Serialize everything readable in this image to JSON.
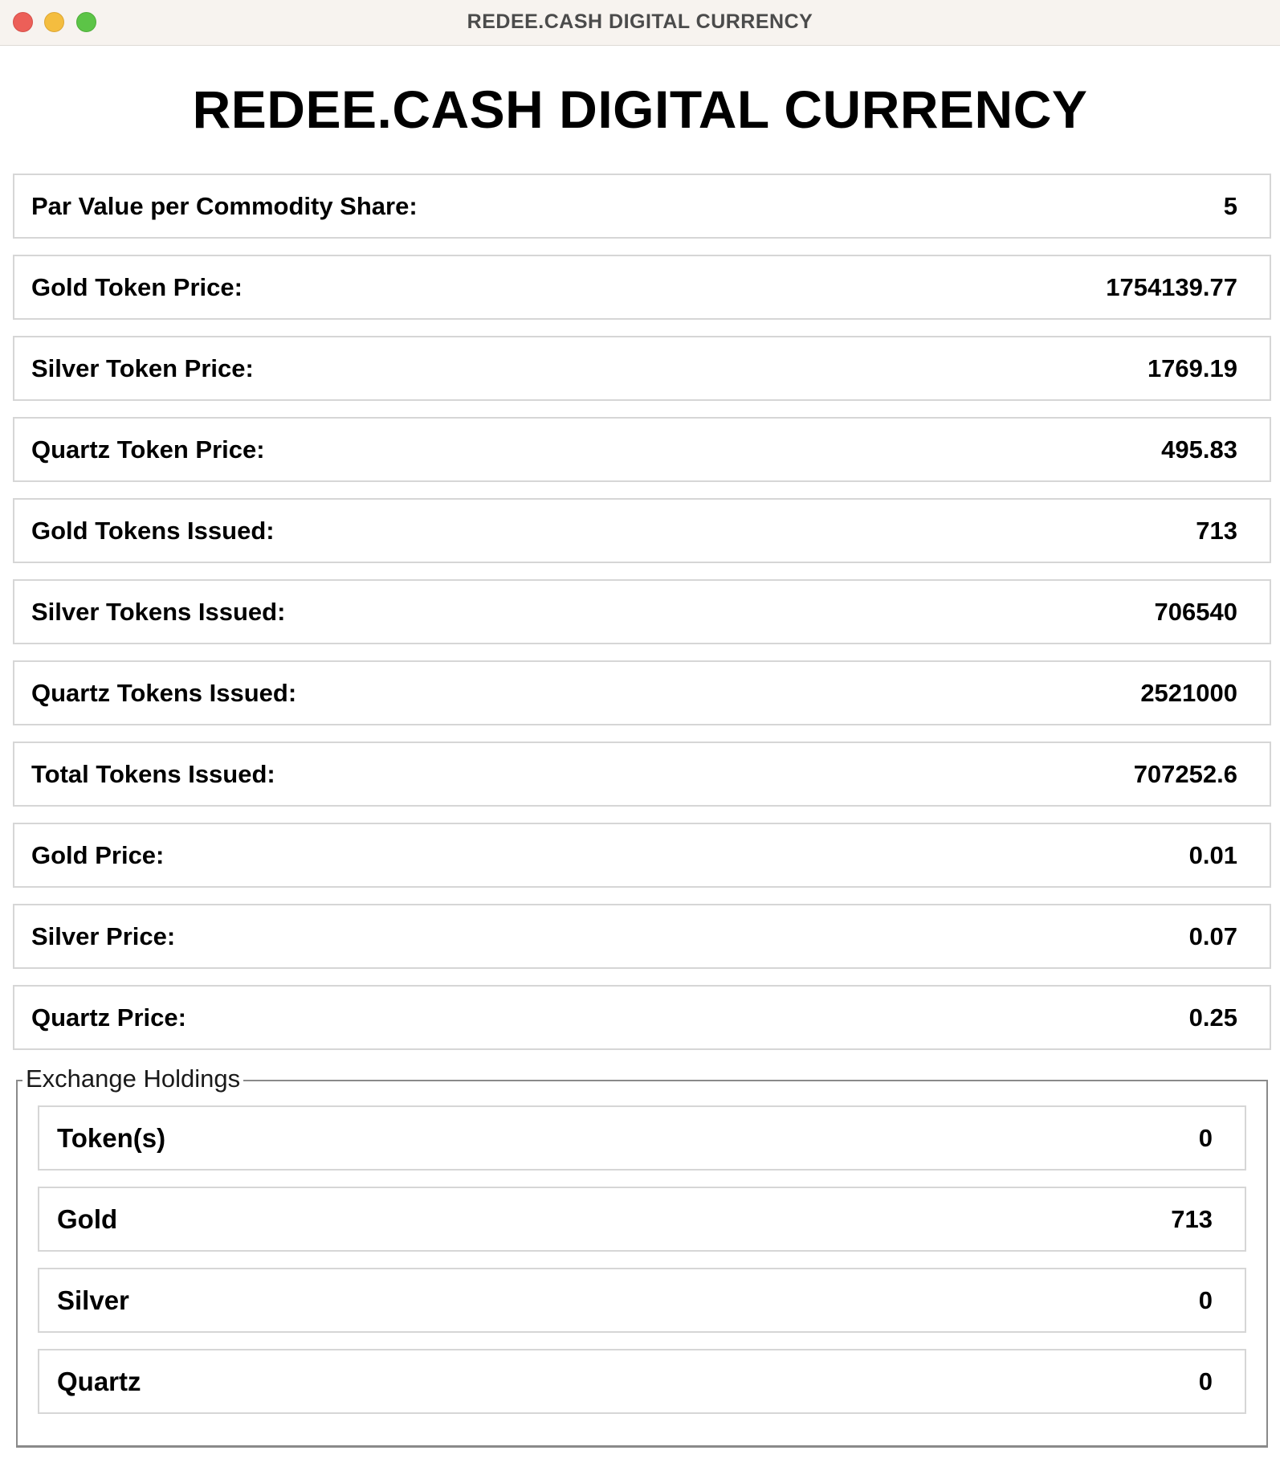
{
  "window": {
    "title": "REDEE.CASH DIGITAL CURRENCY"
  },
  "heading": "REDEE.CASH DIGITAL CURRENCY",
  "stats": [
    {
      "label": "Par Value per Commodity Share:",
      "value": "5"
    },
    {
      "label": "Gold Token Price:",
      "value": "1754139.77"
    },
    {
      "label": "Silver Token Price:",
      "value": "1769.19"
    },
    {
      "label": "Quartz Token Price:",
      "value": "495.83"
    },
    {
      "label": "Gold Tokens Issued:",
      "value": "713"
    },
    {
      "label": "Silver Tokens Issued:",
      "value": "706540"
    },
    {
      "label": "Quartz Tokens Issued:",
      "value": "2521000"
    },
    {
      "label": "Total Tokens Issued:",
      "value": "707252.6"
    },
    {
      "label": "Gold Price:",
      "value": "0.01"
    },
    {
      "label": "Silver Price:",
      "value": "0.07"
    },
    {
      "label": "Quartz Price:",
      "value": "0.25"
    }
  ],
  "exchange_holdings": {
    "legend": "Exchange Holdings",
    "items": [
      {
        "label": "Token(s)",
        "value": "0"
      },
      {
        "label": "Gold",
        "value": "713"
      },
      {
        "label": "Silver",
        "value": "0"
      },
      {
        "label": "Quartz",
        "value": "0"
      }
    ]
  },
  "colors": {
    "titlebar_bg": "#f7f3ef",
    "close_button": "#ec5f58",
    "minimize_button": "#f4bd3f",
    "maximize_button": "#5cc447",
    "row_border": "#d6d6d6",
    "fieldset_border": "#8a8a8a"
  }
}
